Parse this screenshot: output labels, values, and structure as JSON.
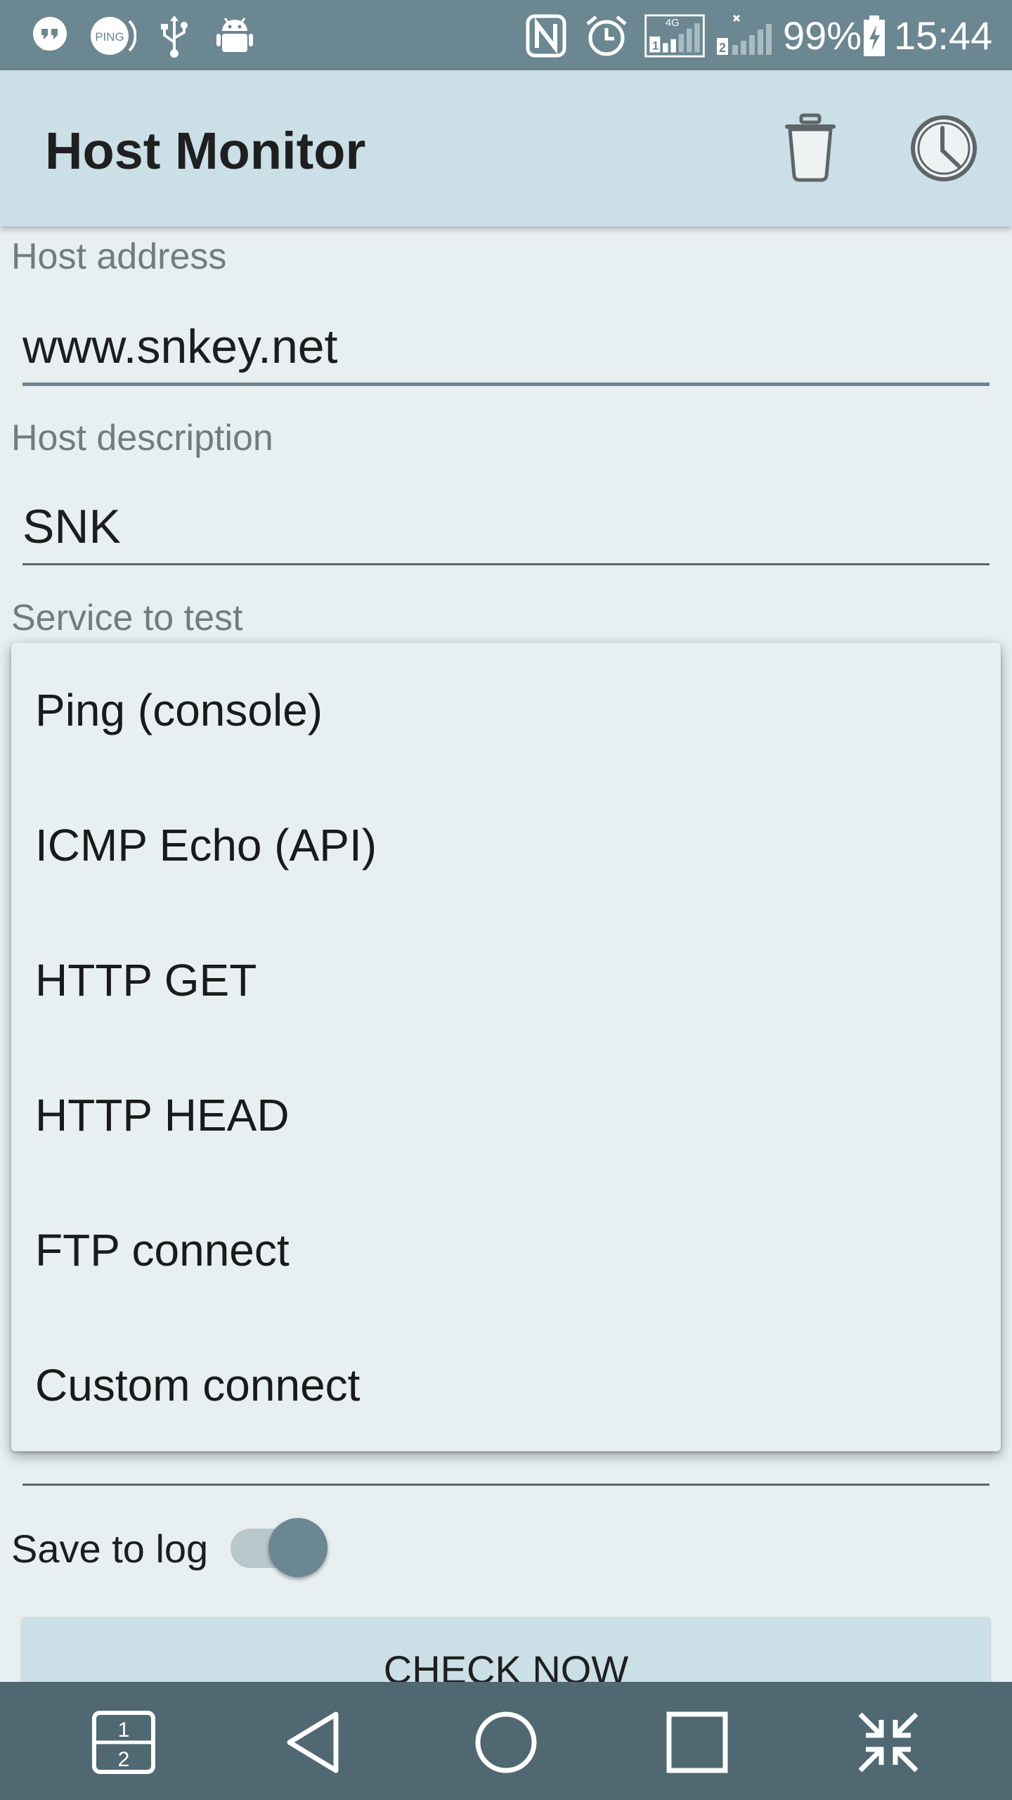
{
  "status_bar": {
    "ping_label": "PING",
    "network_label": "4G",
    "sim1_label": "1",
    "sim2_label": "2",
    "battery": "99%",
    "time": "15:44"
  },
  "app_bar": {
    "title": "Host Monitor"
  },
  "form": {
    "host_address_label": "Host address",
    "host_address_value": "www.snkey.net",
    "host_description_label": "Host description",
    "host_description_value": "SNK",
    "service_label": "Service to test"
  },
  "service_dropdown": {
    "options": [
      "Ping (console)",
      "ICMP Echo (API)",
      "HTTP GET",
      "HTTP HEAD",
      "FTP connect",
      "Custom connect"
    ]
  },
  "save_to_log": {
    "label": "Save to log",
    "enabled": true
  },
  "check_button": {
    "label": "CHECK NOW"
  },
  "nav_bar": {
    "dual_window_label_top": "1",
    "dual_window_label_bottom": "2"
  },
  "colors": {
    "status_bar": "#6b8791",
    "app_bar": "#cadfe6",
    "background": "#e8eff1",
    "nav_bar": "#4f6872",
    "accent": "#6b8791"
  }
}
